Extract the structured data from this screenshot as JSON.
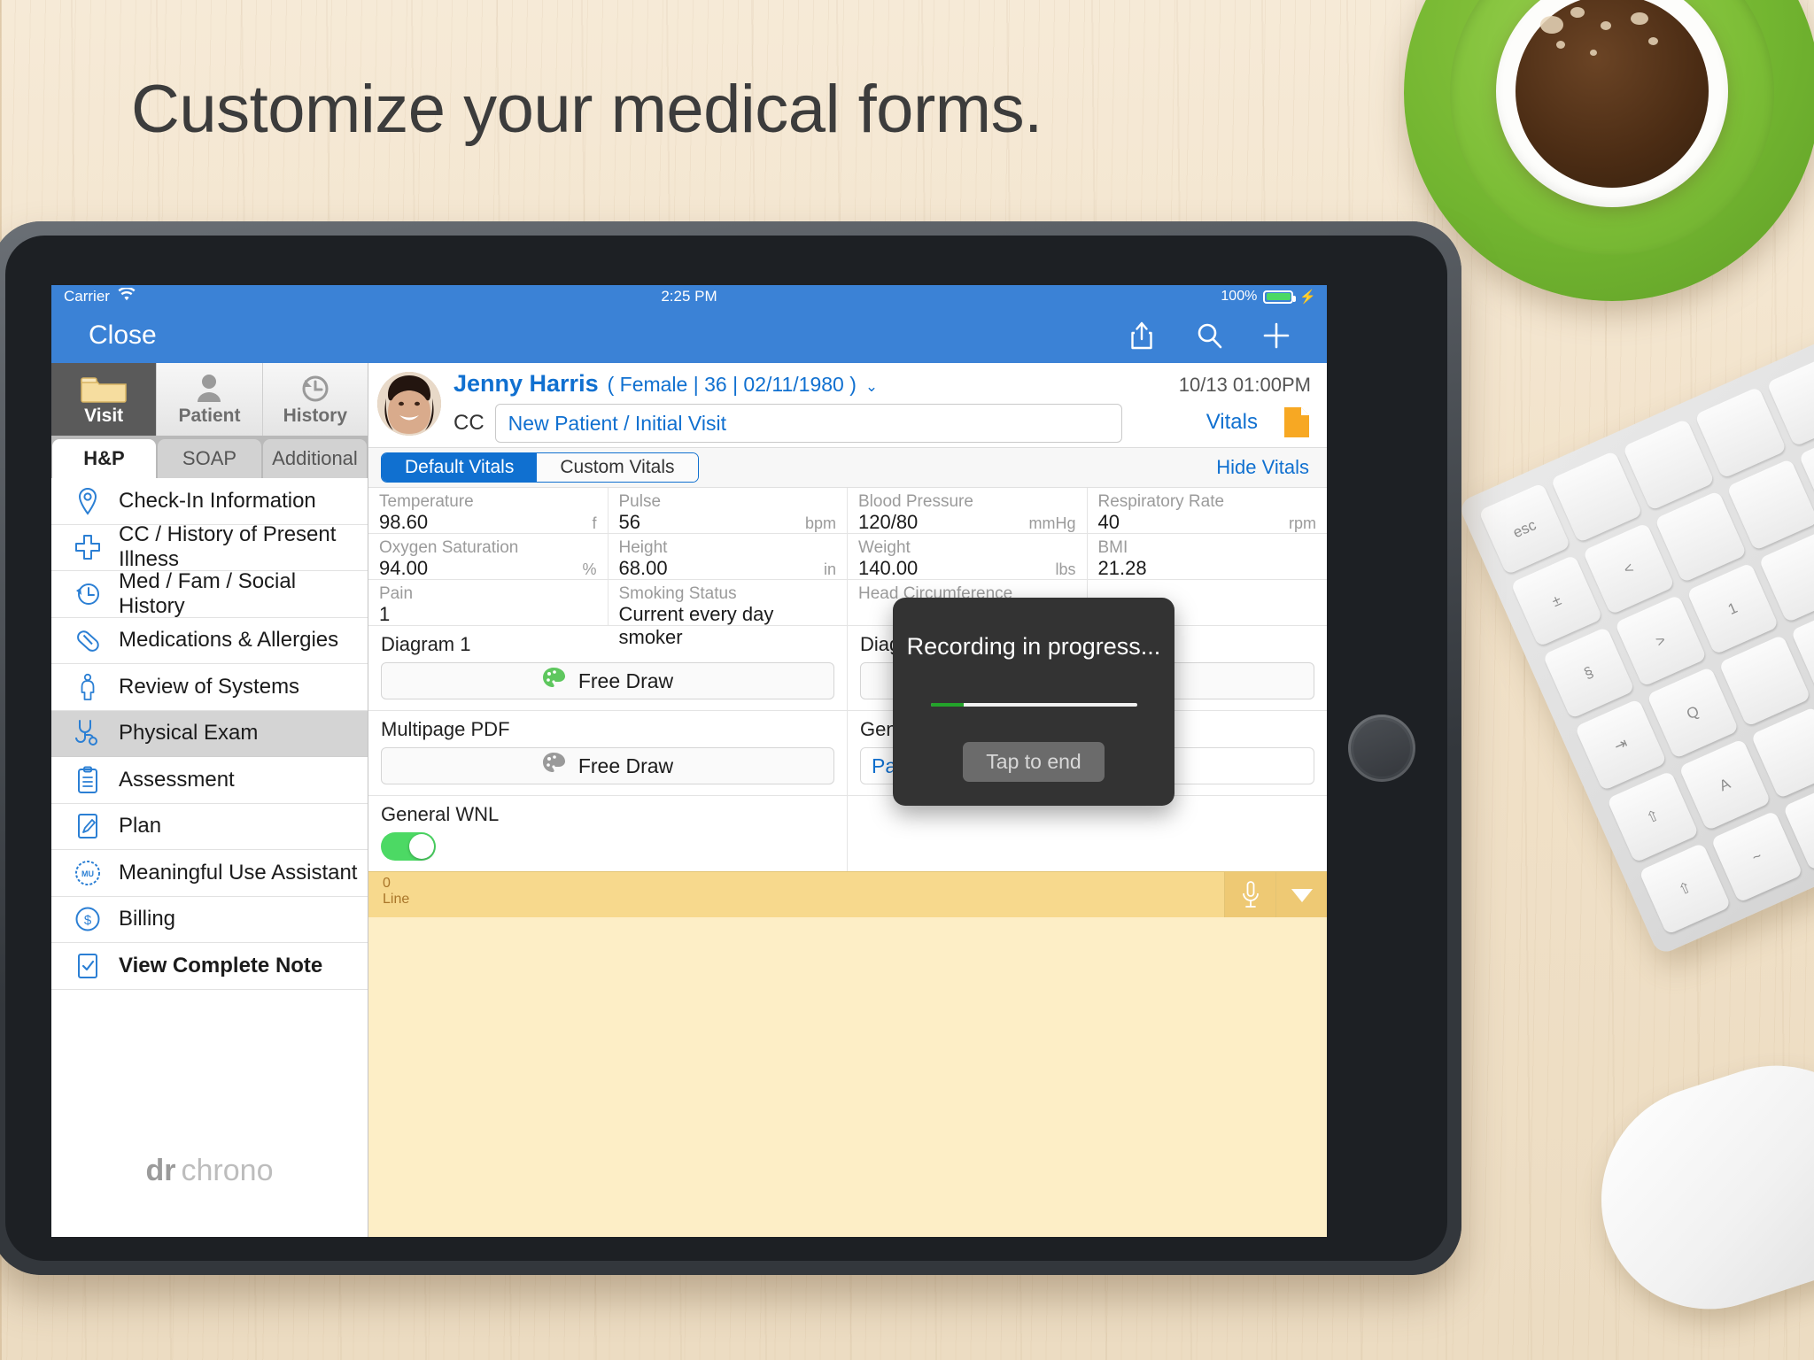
{
  "headline": "Customize your medical forms.",
  "statusbar": {
    "carrier": "Carrier",
    "wifi_icon": "wifi-icon",
    "time": "2:25 PM",
    "battery_percent": "100%",
    "battery_icon": "battery-full-icon",
    "charging_icon": "lightning-bolt-icon"
  },
  "navbar": {
    "close_label": "Close",
    "share_icon": "share-icon",
    "search_icon": "search-icon",
    "add_icon": "plus-icon"
  },
  "top_segments": [
    {
      "label": "Visit",
      "icon": "folder-icon",
      "active": true
    },
    {
      "label": "Patient",
      "icon": "person-icon",
      "active": false
    },
    {
      "label": "History",
      "icon": "clock-rewind-icon",
      "active": false
    }
  ],
  "sub_tabs": [
    {
      "label": "H&P",
      "active": true
    },
    {
      "label": "SOAP",
      "active": false
    },
    {
      "label": "Additional",
      "active": false
    }
  ],
  "sidebar": {
    "items": [
      {
        "label": "Check-In Information",
        "icon": "map-pin-icon",
        "selected": false,
        "bold": false
      },
      {
        "label": "CC / History of Present Illness",
        "icon": "medical-cross-icon",
        "selected": false,
        "bold": false
      },
      {
        "label": "Med / Fam / Social History",
        "icon": "clock-rewind-icon",
        "selected": false,
        "bold": false
      },
      {
        "label": "Medications & Allergies",
        "icon": "pill-icon",
        "selected": false,
        "bold": false
      },
      {
        "label": "Review of Systems",
        "icon": "body-icon",
        "selected": false,
        "bold": false
      },
      {
        "label": "Physical Exam",
        "icon": "stethoscope-icon",
        "selected": true,
        "bold": false
      },
      {
        "label": "Assessment",
        "icon": "clipboard-checklist-icon",
        "selected": false,
        "bold": false
      },
      {
        "label": "Plan",
        "icon": "pen-document-icon",
        "selected": false,
        "bold": false
      },
      {
        "label": "Meaningful Use Assistant",
        "icon": "mu-badge-icon",
        "selected": false,
        "bold": false
      },
      {
        "label": "Billing",
        "icon": "dollar-circle-icon",
        "selected": false,
        "bold": false
      },
      {
        "label": "View Complete Note",
        "icon": "checked-document-icon",
        "selected": false,
        "bold": true
      }
    ],
    "brand_mark": "dr",
    "brand_name": "chrono"
  },
  "patient": {
    "avatar": "patient-photo",
    "name": "Jenny Harris",
    "meta": "( Female | 36 | 02/11/1980 )",
    "caret_icon": "chevron-down-icon",
    "cc_label": "CC",
    "cc_value": "New Patient / Initial Visit",
    "appointment_datetime": "10/13 01:00PM",
    "vitals_link": "Vitals",
    "doc_icon": "document-icon"
  },
  "vitals_toolbar": {
    "default_tab": "Default Vitals",
    "custom_tab": "Custom Vitals",
    "hide_link": "Hide Vitals",
    "active_tab": "Default Vitals"
  },
  "vitals": [
    {
      "label": "Temperature",
      "value": "98.60",
      "unit": "f"
    },
    {
      "label": "Pulse",
      "value": "56",
      "unit": "bpm"
    },
    {
      "label": "Blood Pressure",
      "value": "120/80",
      "unit": "mmHg"
    },
    {
      "label": "Respiratory Rate",
      "value": "40",
      "unit": "rpm"
    },
    {
      "label": "Oxygen Saturation",
      "value": "94.00",
      "unit": "%"
    },
    {
      "label": "Height",
      "value": "68.00",
      "unit": "in"
    },
    {
      "label": "Weight",
      "value": "140.00",
      "unit": "lbs"
    },
    {
      "label": "BMI",
      "value": "21.28",
      "unit": ""
    },
    {
      "label": "Pain",
      "value": "1",
      "unit": ""
    },
    {
      "label": "Smoking Status",
      "value": "Current every day smoker",
      "unit": ""
    },
    {
      "label": "Head Circumference",
      "value": "",
      "unit": ""
    },
    {
      "label": "",
      "value": "",
      "unit": ""
    }
  ],
  "form_rows": [
    {
      "label": "Diagram 1",
      "control": "free_draw",
      "button_label": "Free Draw",
      "palette_color": "#5ec75e"
    },
    {
      "label": "Diagram 2",
      "control": "empty",
      "button_label": "",
      "palette_color": ""
    },
    {
      "label": "Multipage PDF",
      "control": "free_draw",
      "button_label": "Free Draw",
      "palette_color": "#9a9a9a"
    },
    {
      "label": "General Notes",
      "control": "link",
      "button_label": "Patient Notes",
      "palette_color": ""
    },
    {
      "label": "General WNL",
      "control": "toggle",
      "button_label": "",
      "palette_color": "#4cd964"
    },
    {
      "label": "",
      "control": "empty",
      "button_label": "",
      "palette_color": ""
    }
  ],
  "accessory_bar": {
    "count": "0",
    "unit_label": "Line",
    "mic_icon": "microphone-icon",
    "dismiss_icon": "chevron-down-triangle-icon"
  },
  "modal": {
    "title": "Recording in progress...",
    "progress_percent": 16,
    "progress_color": "#23a32a",
    "button_label": "Tap to end"
  },
  "theme": {
    "accent_blue": "#3b82d6",
    "link_blue": "#1070d0",
    "selected_gray": "#d4d4d4",
    "note_yellow": "#fdeec6",
    "accessory_yellow": "#f7d98d"
  }
}
